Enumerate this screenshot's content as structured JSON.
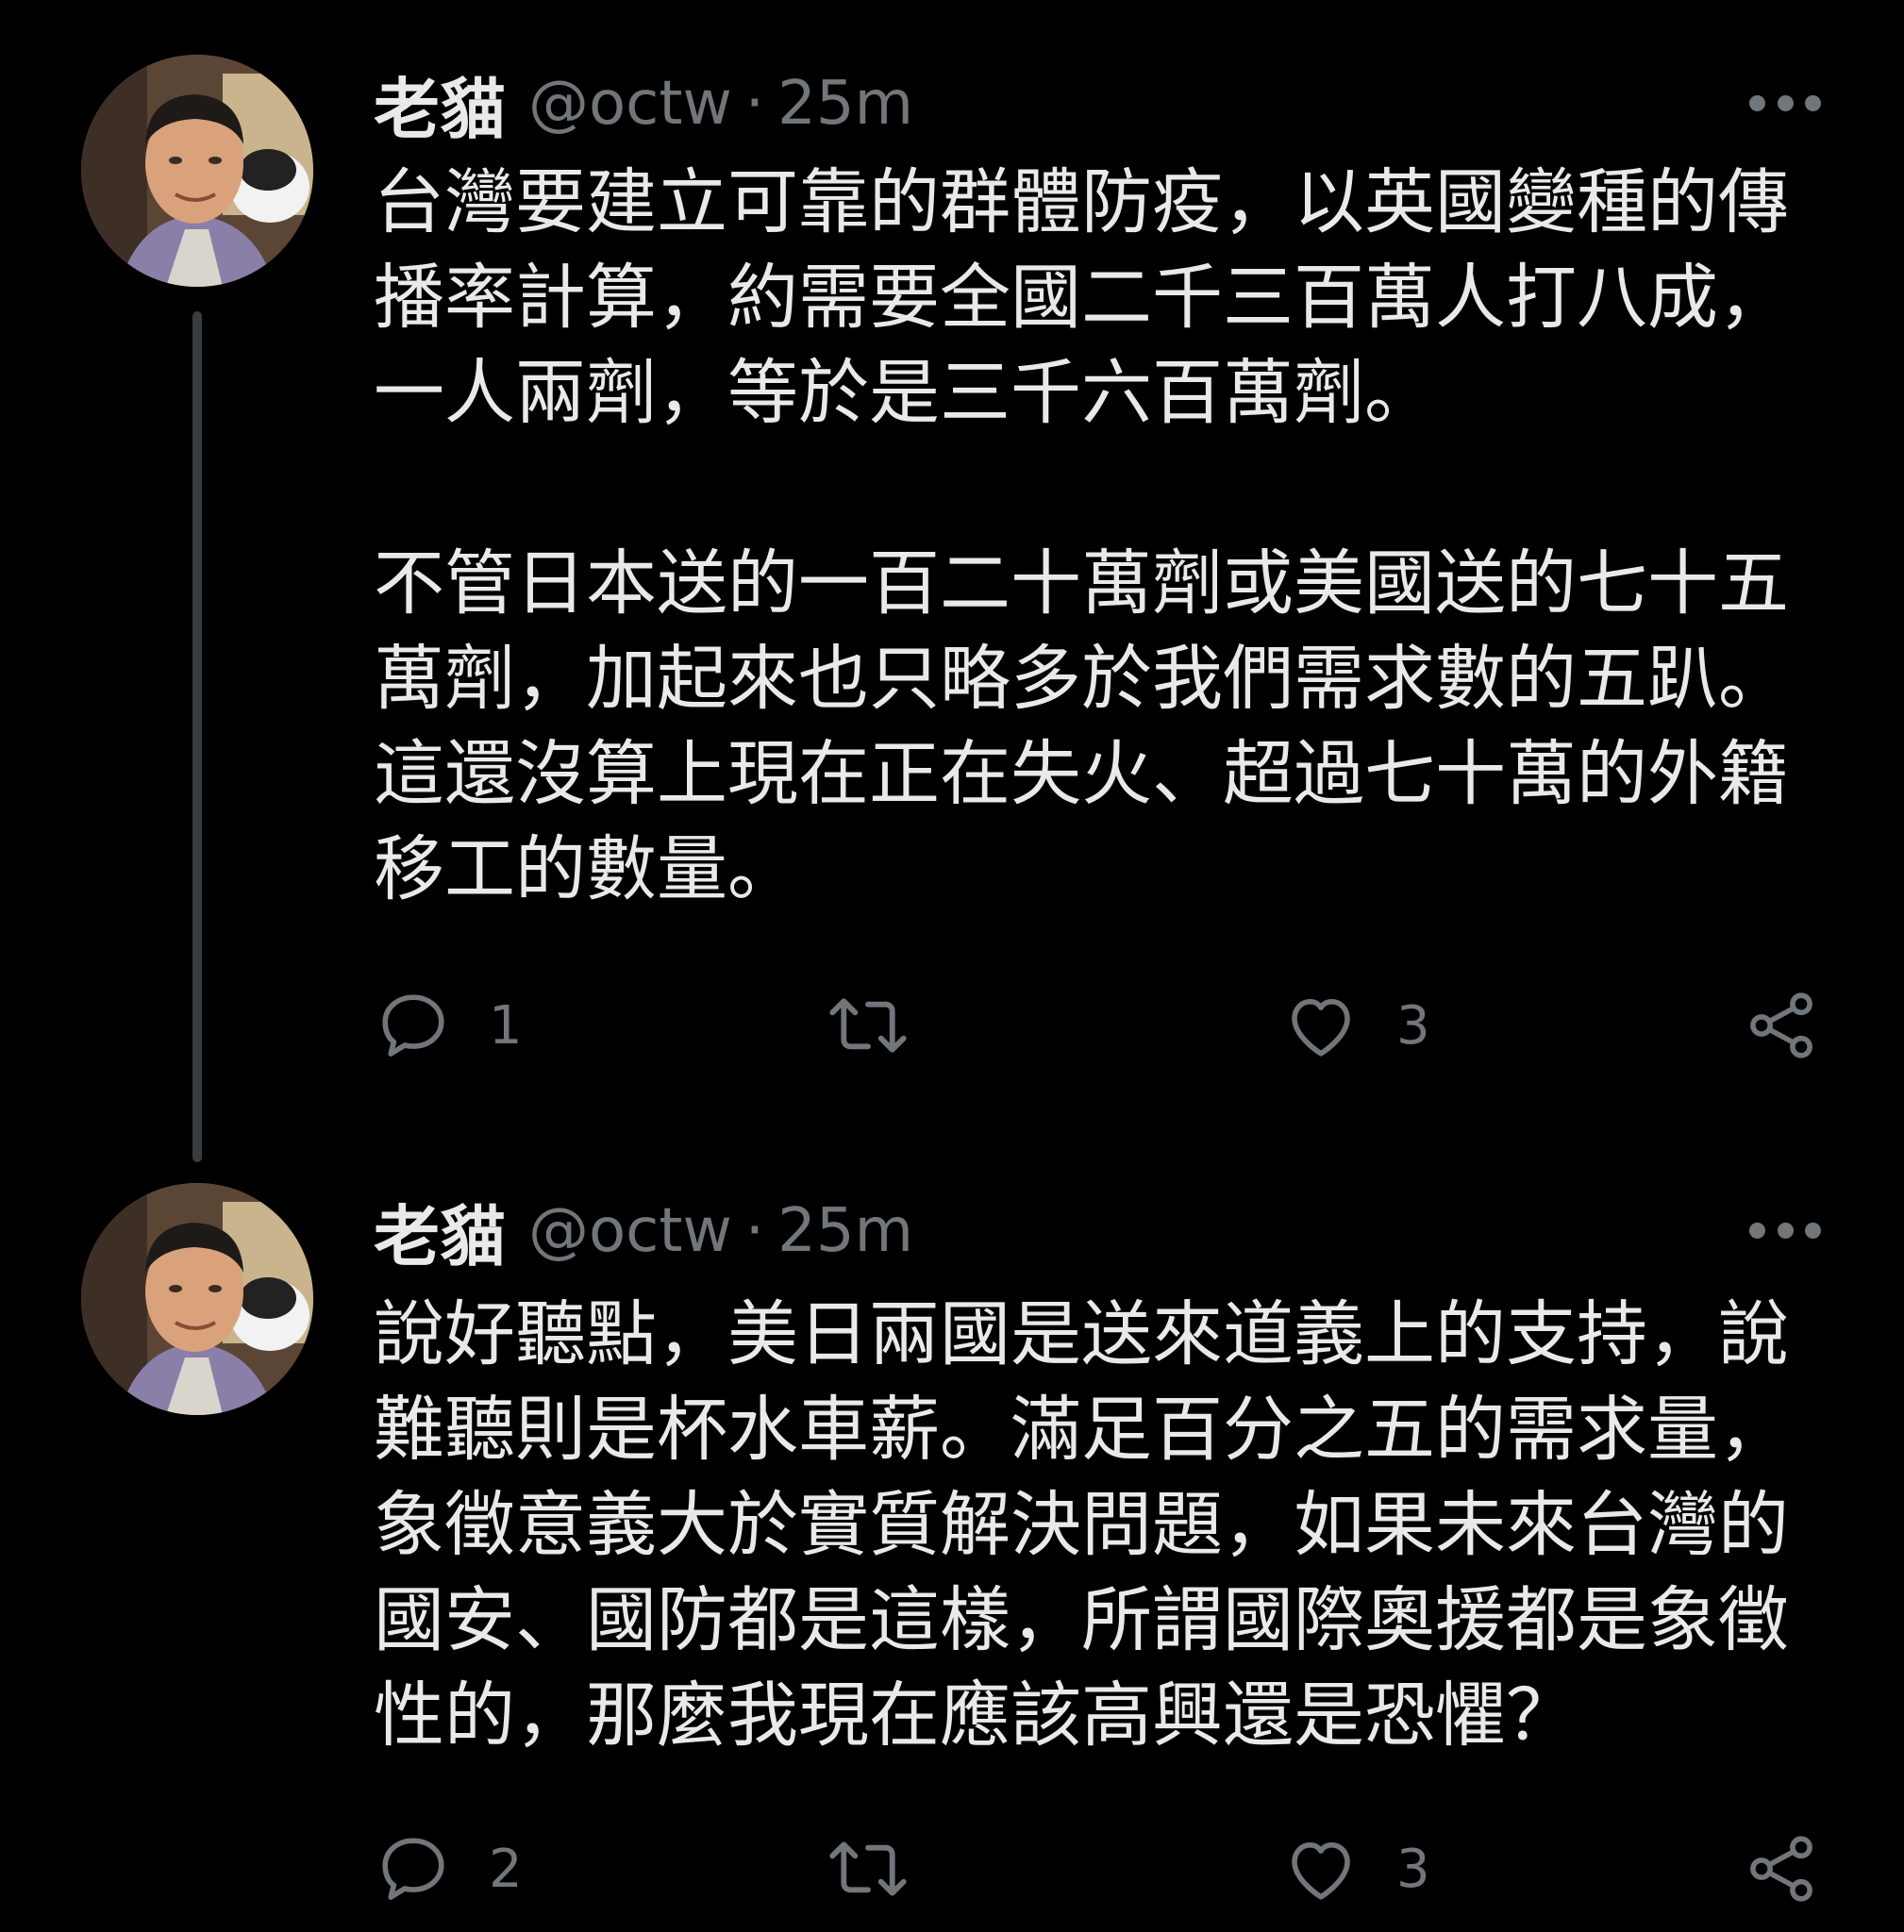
{
  "tweets": [
    {
      "name": "老貓",
      "handle": "@octw",
      "separator": "·",
      "time": "25m",
      "paragraphs": [
        [
          "台灣要建立可靠的群體防疫，以英國變種的傳",
          "播率計算，約需要全國二千三百萬人打八成，",
          "一人兩劑，等於是三千六百萬劑。"
        ],
        [
          "不管日本送的一百二十萬劑或美國送的七十五",
          "萬劑，加起來也只略多於我們需求數的五趴。",
          "這還沒算上現在正在失火、超過七十萬的外籍",
          "移工的數量。"
        ]
      ],
      "reply_count": "1",
      "retweet_count": "",
      "like_count": "3"
    },
    {
      "name": "老貓",
      "handle": "@octw",
      "separator": "·",
      "time": "25m",
      "paragraphs": [
        [
          "說好聽點，美日兩國是送來道義上的支持，說",
          "難聽則是杯水車薪。滿足百分之五的需求量，",
          "象徵意義大於實質解決問題，如果未來台灣的",
          "國安、國防都是這樣，所謂國際奧援都是象徵",
          "性的，那麼我現在應該高興還是恐懼？"
        ]
      ],
      "reply_count": "2",
      "retweet_count": "",
      "like_count": "3"
    }
  ],
  "icons": {
    "more": "more-horizontal-icon",
    "reply": "reply-bubble-icon",
    "retweet": "retweet-arrows-icon",
    "like": "heart-icon",
    "share": "share-nodes-icon"
  },
  "colors": {
    "background": "#000000",
    "text": "#e7e9ea",
    "secondary": "#71767b",
    "thread_line": "#3a3d40"
  }
}
